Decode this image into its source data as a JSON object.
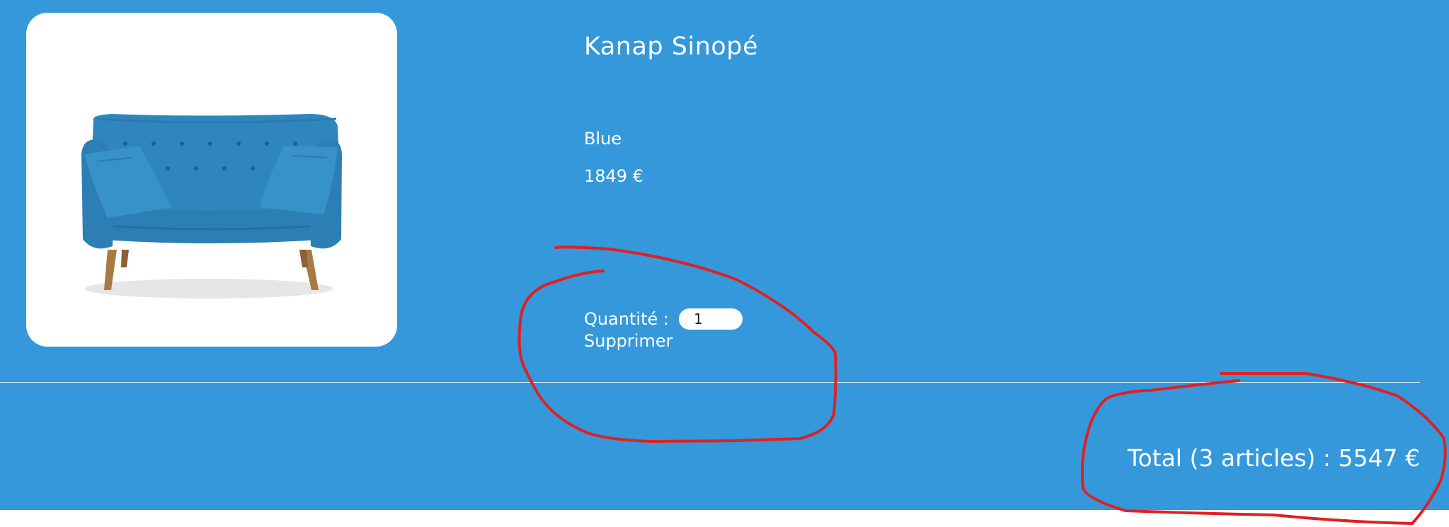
{
  "cart": {
    "item": {
      "image_alt": "blue-sofa",
      "name": "Kanap Sinopé",
      "color": "Blue",
      "price": "1849 €",
      "quantity_label": "Quantité :",
      "quantity_value": "1",
      "delete_label": "Supprimer"
    },
    "total": {
      "label": "Total (",
      "count": "3",
      "articles_label": " articles) : ",
      "amount": "5547",
      "currency": " €"
    }
  },
  "colors": {
    "background": "#3498db",
    "text": "#ffffff",
    "annotation": "#e02020",
    "sofa": "#2f86bd"
  }
}
